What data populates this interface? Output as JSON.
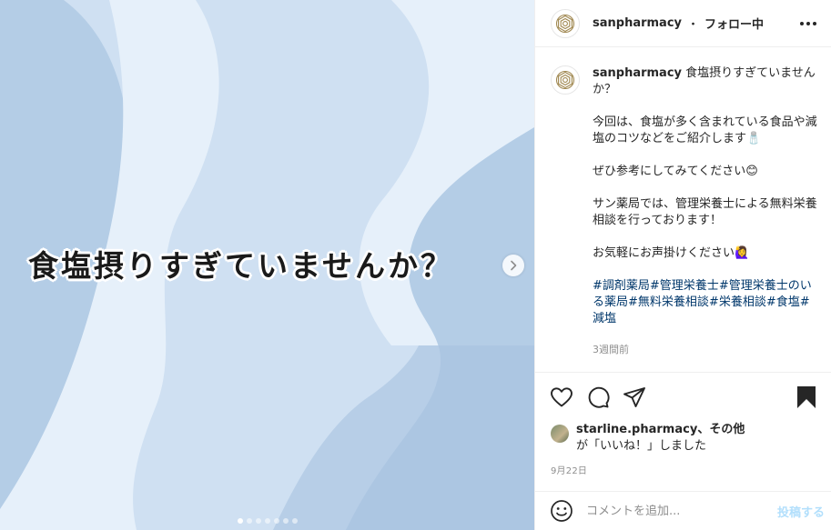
{
  "slide": {
    "title": "食塩摂りすぎていませんか？",
    "dot_count": 7,
    "active_dot": 0
  },
  "post": {
    "username": "sanpharmacy",
    "separator": "・",
    "follow_status": "フォロー中",
    "caption_title": "食塩摂りすぎていませんか？",
    "caption_paragraphs": [
      "今回は、食塩が多く含まれている食品や減塩のコツなどをご紹介します🧂",
      "ぜひ参考にしてみてください😊",
      "サン薬局では、管理栄養士による無料栄養相談を行っております！",
      "お気軽にお声掛けください🙋‍♀️"
    ],
    "hashtags": [
      "#調剤薬局",
      "#管理栄養士",
      "#管理栄養士のいる薬局",
      "#無料栄養相談",
      "#栄養相談",
      "#食塩",
      "#減塩"
    ],
    "time_ago": "3週間前",
    "likes": {
      "first_user": "starline.pharmacy",
      "others": "、その他",
      "suffix": "が「いいね！」しました"
    },
    "date": "9月22日",
    "comment_placeholder": "コメントを追加...",
    "post_button": "投稿する"
  },
  "icons": {
    "heart": "heart-icon",
    "comment": "comment-icon",
    "share": "share-icon",
    "save": "bookmark-icon",
    "emoji": "smiley-icon",
    "next": "chevron-right-icon",
    "more": "more-horizontal-icon"
  },
  "colors": {
    "slide_light": "#e6f0fa",
    "slide_mid": "#cfe0f2",
    "slide_dark": "#b4cde6",
    "hashtag": "#00376b",
    "post_disabled": "#b2dffc",
    "logo_gold": "#a08850"
  }
}
